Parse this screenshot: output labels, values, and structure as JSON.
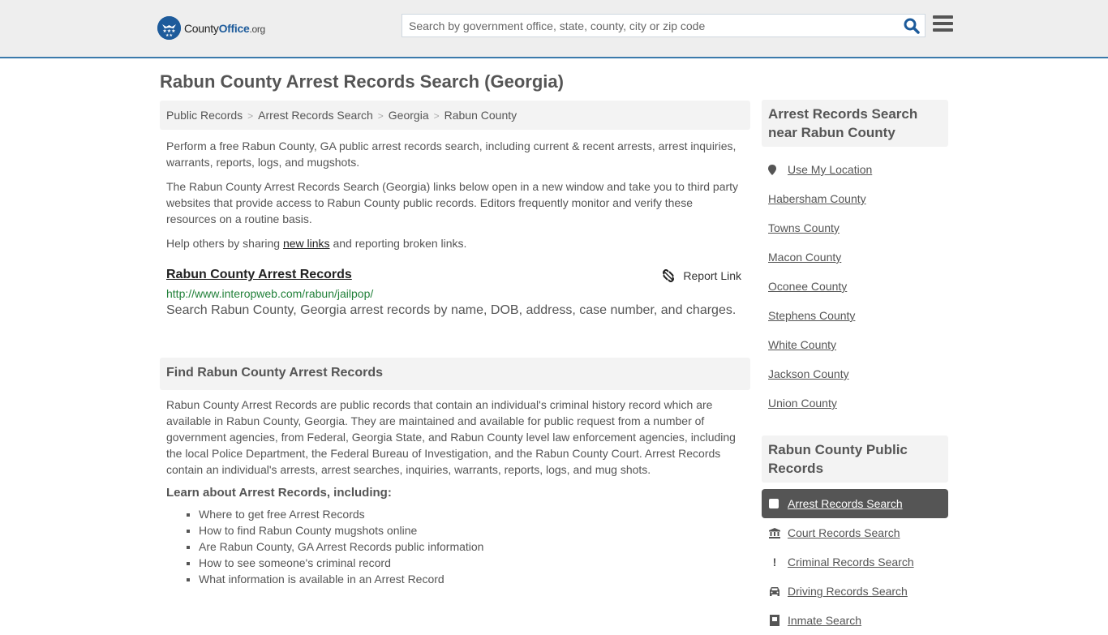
{
  "header": {
    "logo": {
      "name_part1": "County",
      "name_part2": "Office",
      "tld": ".org"
    },
    "search": {
      "placeholder": "Search by government office, state, county, city or zip code",
      "value": ""
    },
    "icons": {
      "search": "search-icon",
      "menu": "hamburger-menu-icon"
    }
  },
  "page": {
    "title": "Rabun County Arrest Records Search (Georgia)",
    "breadcrumb": [
      "Public Records",
      "Arrest Records Search",
      "Georgia",
      "Rabun County"
    ],
    "intro": [
      "Perform a free Rabun County, GA public arrest records search, including current & recent arrests, arrest inquiries, warrants, reports, logs, and mugshots.",
      "The Rabun County Arrest Records Search (Georgia) links below open in a new window and take you to third party websites that provide access to Rabun County public records. Editors frequently monitor and verify these resources on a routine basis."
    ],
    "help": {
      "before": "Help others by sharing ",
      "link": "new links",
      "after": " and reporting broken links."
    }
  },
  "result": {
    "title": "Rabun County Arrest Records",
    "url": "http://www.interopweb.com/rabun/jailpop/",
    "description": "Search Rabun County, Georgia arrest records by name, DOB, address, case number, and charges.",
    "report_label": "Report Link"
  },
  "find": {
    "heading": "Find Rabun County Arrest Records",
    "body": "Rabun County Arrest Records are public records that contain an individual's criminal history record which are available in Rabun County, Georgia. They are maintained and available for public request from a number of government agencies, from Federal, Georgia State, and Rabun County level law enforcement agencies, including the local Police Department, the Federal Bureau of Investigation, and the Rabun County Court. Arrest Records contain an individual's arrests, arrest searches, inquiries, warrants, reports, logs, and mug shots.",
    "learn_heading": "Learn about Arrest Records, including:",
    "learn_items": [
      "Where to get free Arrest Records",
      "How to find Rabun County mugshots online",
      "Are Rabun County, GA Arrest Records public information",
      "How to see someone's criminal record",
      "What information is available in an Arrest Record"
    ]
  },
  "sidebar": {
    "near": {
      "heading": "Arrest Records Search near Rabun County",
      "use_location": "Use My Location",
      "counties": [
        "Habersham County",
        "Towns County",
        "Macon County",
        "Oconee County",
        "Stephens County",
        "White County",
        "Jackson County",
        "Union County"
      ]
    },
    "public_records": {
      "heading": "Rabun County Public Records",
      "items": [
        {
          "label": "Arrest Records Search",
          "icon": "square-icon",
          "active": true
        },
        {
          "label": "Court Records Search",
          "icon": "courthouse-icon",
          "active": false
        },
        {
          "label": "Criminal Records Search",
          "icon": "exclamation-icon",
          "active": false
        },
        {
          "label": "Driving Records Search",
          "icon": "car-icon",
          "active": false
        },
        {
          "label": "Inmate Search",
          "icon": "inmate-icon",
          "active": false
        }
      ]
    }
  },
  "colors": {
    "brand_blue": "#1d5b9b",
    "header_border": "#3b7aab",
    "url_green": "#22813a",
    "active_bg": "#555555"
  }
}
